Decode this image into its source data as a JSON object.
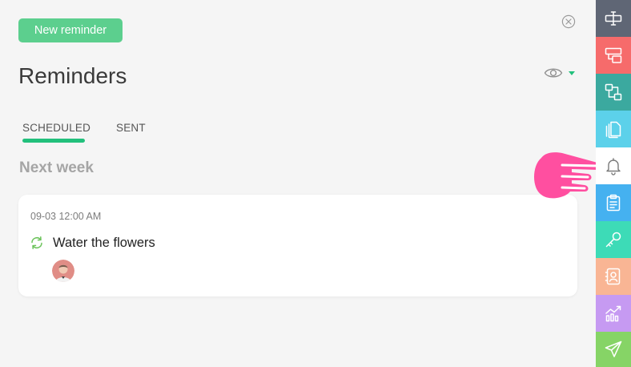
{
  "toolbar": {
    "new_reminder_label": "New reminder"
  },
  "header": {
    "title": "Reminders"
  },
  "tabs": [
    {
      "label": "SCHEDULED",
      "active": true
    },
    {
      "label": "SENT",
      "active": false
    }
  ],
  "section": {
    "heading": "Next week"
  },
  "reminders": [
    {
      "date": "09-03 12:00 AM",
      "title": "Water the flowers",
      "repeat": true
    }
  ],
  "colors": {
    "accent": "#5ccf8e",
    "tab_active": "#22c07c",
    "pointer": "#ff4fa0"
  },
  "sidebar": {
    "items": [
      {
        "icon": "text-field-icon",
        "color": "#5f6675"
      },
      {
        "icon": "form-icon",
        "color": "#f66b6b"
      },
      {
        "icon": "relations-icon",
        "color": "#3ba99f"
      },
      {
        "icon": "files-icon",
        "color": "#5cd1ea"
      },
      {
        "icon": "bell-icon",
        "color": "#ffffff",
        "active": true
      },
      {
        "icon": "clipboard-icon",
        "color": "#45b1f0"
      },
      {
        "icon": "key-icon",
        "color": "#3ddbb7"
      },
      {
        "icon": "contact-icon",
        "color": "#f9b594"
      },
      {
        "icon": "chart-icon",
        "color": "#c69af2"
      },
      {
        "icon": "send-icon",
        "color": "#86d466"
      }
    ]
  }
}
